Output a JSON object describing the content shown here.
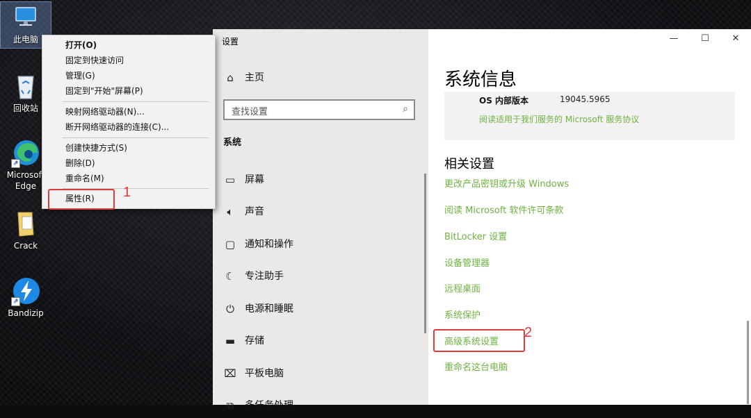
{
  "desktop": {
    "icons": [
      {
        "label": "此电脑"
      },
      {
        "label": "回收站"
      },
      {
        "label": "Microsoft\nEdge"
      },
      {
        "label": "Crack"
      },
      {
        "label": "Bandizip"
      }
    ]
  },
  "context_menu": {
    "items": [
      {
        "label": "打开(O)"
      },
      {
        "label": "固定到快速访问"
      },
      {
        "label": "管理(G)"
      },
      {
        "label": "固定到\"开始\"屏幕(P)"
      },
      {
        "label": "映射网络驱动器(N)..."
      },
      {
        "label": "断开网络驱动器的连接(C)..."
      },
      {
        "label": "创建快捷方式(S)"
      },
      {
        "label": "删除(D)"
      },
      {
        "label": "重命名(M)"
      },
      {
        "label": "属性(R)"
      }
    ]
  },
  "annotations": {
    "step1": "1",
    "step2": "2"
  },
  "settings": {
    "window_title": "设置",
    "home_label": "主页",
    "search_placeholder": "查找设置",
    "section_label": "系统",
    "nav": [
      {
        "label": "屏幕",
        "icon": "monitor-icon"
      },
      {
        "label": "声音",
        "icon": "speaker-icon"
      },
      {
        "label": "通知和操作",
        "icon": "notification-icon"
      },
      {
        "label": "专注助手",
        "icon": "moon-icon"
      },
      {
        "label": "电源和睡眠",
        "icon": "power-icon"
      },
      {
        "label": "存储",
        "icon": "storage-icon"
      },
      {
        "label": "平板电脑",
        "icon": "tablet-icon"
      },
      {
        "label": "多任务处理",
        "icon": "multitask-icon"
      }
    ],
    "page_title": "系统信息",
    "info": {
      "key": "OS 内部版本",
      "value": "19045.5965",
      "link": "阅读适用于我们服务的 Microsoft 服务协议"
    },
    "related_title": "相关设置",
    "related_links": [
      {
        "label": "更改产品密钥或升级 Windows"
      },
      {
        "label": "阅读 Microsoft 软件许可条款"
      },
      {
        "label": "BitLocker 设置"
      },
      {
        "label": "设备管理器"
      },
      {
        "label": "远程桌面"
      },
      {
        "label": "系统保护"
      },
      {
        "label": "高级系统设置"
      },
      {
        "label": "重命名这台电脑"
      }
    ],
    "colors": {
      "link": "#6db33f",
      "annotation": "#e23b3b",
      "left_pane": "#e9e9e9"
    }
  }
}
